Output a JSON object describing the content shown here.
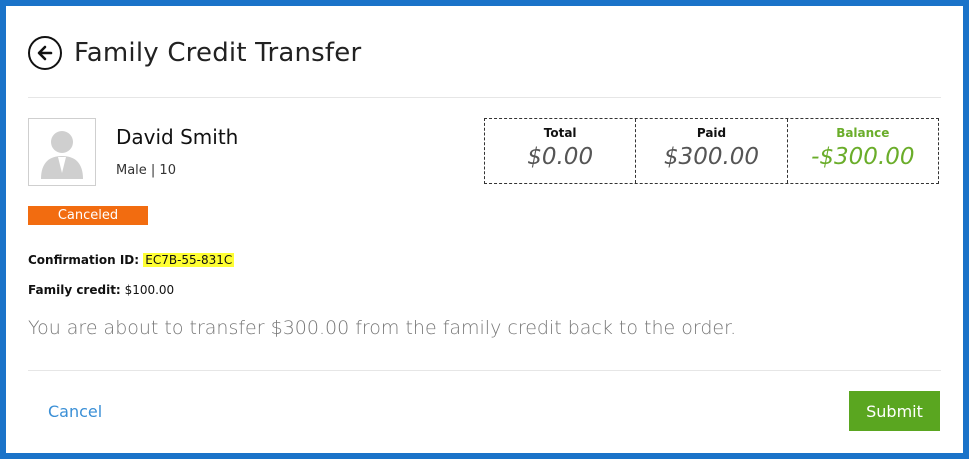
{
  "header": {
    "title": "Family Credit Transfer",
    "back_icon": "arrow-left-circle-icon"
  },
  "profile": {
    "name": "David Smith",
    "gender_age": "Male | 10",
    "avatar_icon": "person-silhouette-icon"
  },
  "summary": {
    "total_label": "Total",
    "total_value": "$0.00",
    "paid_label": "Paid",
    "paid_value": "$300.00",
    "balance_label": "Balance",
    "balance_value": "-$300.00",
    "balance_color": "#6aad2a"
  },
  "status": {
    "label": "Canceled",
    "color": "#f26c10"
  },
  "confirmation": {
    "label": "Confirmation ID:",
    "value": "EC7B-55-831C"
  },
  "family_credit": {
    "label": "Family credit:",
    "value": "$100.00"
  },
  "message": "You are about to transfer $300.00 from the family credit back to the order.",
  "actions": {
    "cancel_label": "Cancel",
    "submit_label": "Submit",
    "submit_color": "#5aa620"
  }
}
